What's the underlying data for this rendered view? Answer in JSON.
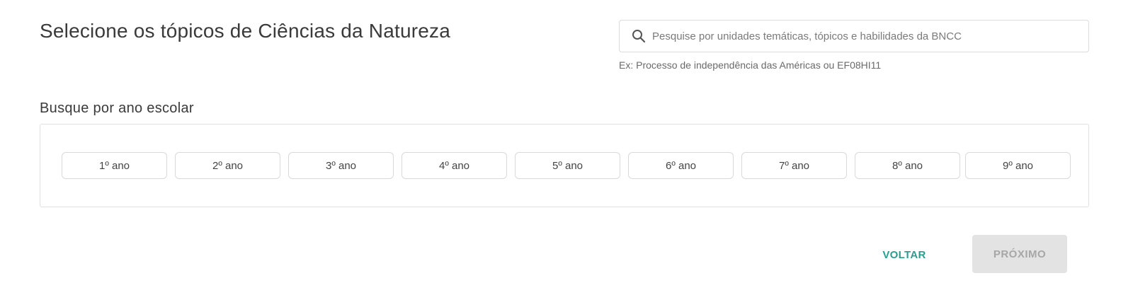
{
  "header": {
    "title": "Selecione os tópicos de Ciências da Natureza"
  },
  "search": {
    "icon": "search-icon",
    "placeholder": "Pesquise por unidades temáticas, tópicos e habilidades da BNCC",
    "value": "",
    "hint": "Ex: Processo de independência das Américas ou EF08HI11"
  },
  "year_filter": {
    "label": "Busque por ano escolar",
    "years": [
      "1º ano",
      "2º ano",
      "3º ano",
      "4º ano",
      "5º ano",
      "6º ano",
      "7º ano",
      "8º ano",
      "9º ano"
    ]
  },
  "actions": {
    "back_label": "VOLTAR",
    "next_label": "PRÓXIMO",
    "next_disabled": true
  },
  "colors": {
    "accent": "#2a9d8f",
    "disabled_bg": "#e3e3e3",
    "disabled_text": "#a7a7a7"
  }
}
